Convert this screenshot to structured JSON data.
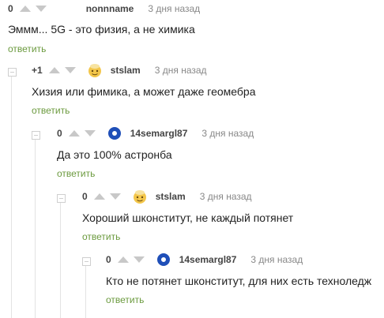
{
  "reply_label": "ответить",
  "comments": [
    {
      "score": "0",
      "username": "nonnname",
      "time": "3 дня назад",
      "text": "Эммм... 5G - это физия, а не химика",
      "avatar": "none"
    },
    {
      "score": "+1",
      "username": "stslam",
      "time": "3 дня назад",
      "text": "Хизия или фимика, а может даже геомебра",
      "avatar": "emoji-face-icon"
    },
    {
      "score": "0",
      "username": "14semargl87",
      "time": "3 дня назад",
      "text": "Да это 100% астронба",
      "avatar": "blue-swirl-icon"
    },
    {
      "score": "0",
      "username": "stslam",
      "time": "3 дня назад",
      "text": "Хороший шконститут, не каждый потянет",
      "avatar": "emoji-face-icon"
    },
    {
      "score": "0",
      "username": "14semargl87",
      "time": "3 дня назад",
      "text": "Кто не потянет шконститут, для них есть техноледж",
      "avatar": "blue-swirl-icon"
    }
  ],
  "colors": {
    "reply": "#6b9a3e",
    "arrow": "#c8c8c8",
    "avatar_blue": "#1f4fb8",
    "avatar_yellow": "#f3c64a"
  }
}
